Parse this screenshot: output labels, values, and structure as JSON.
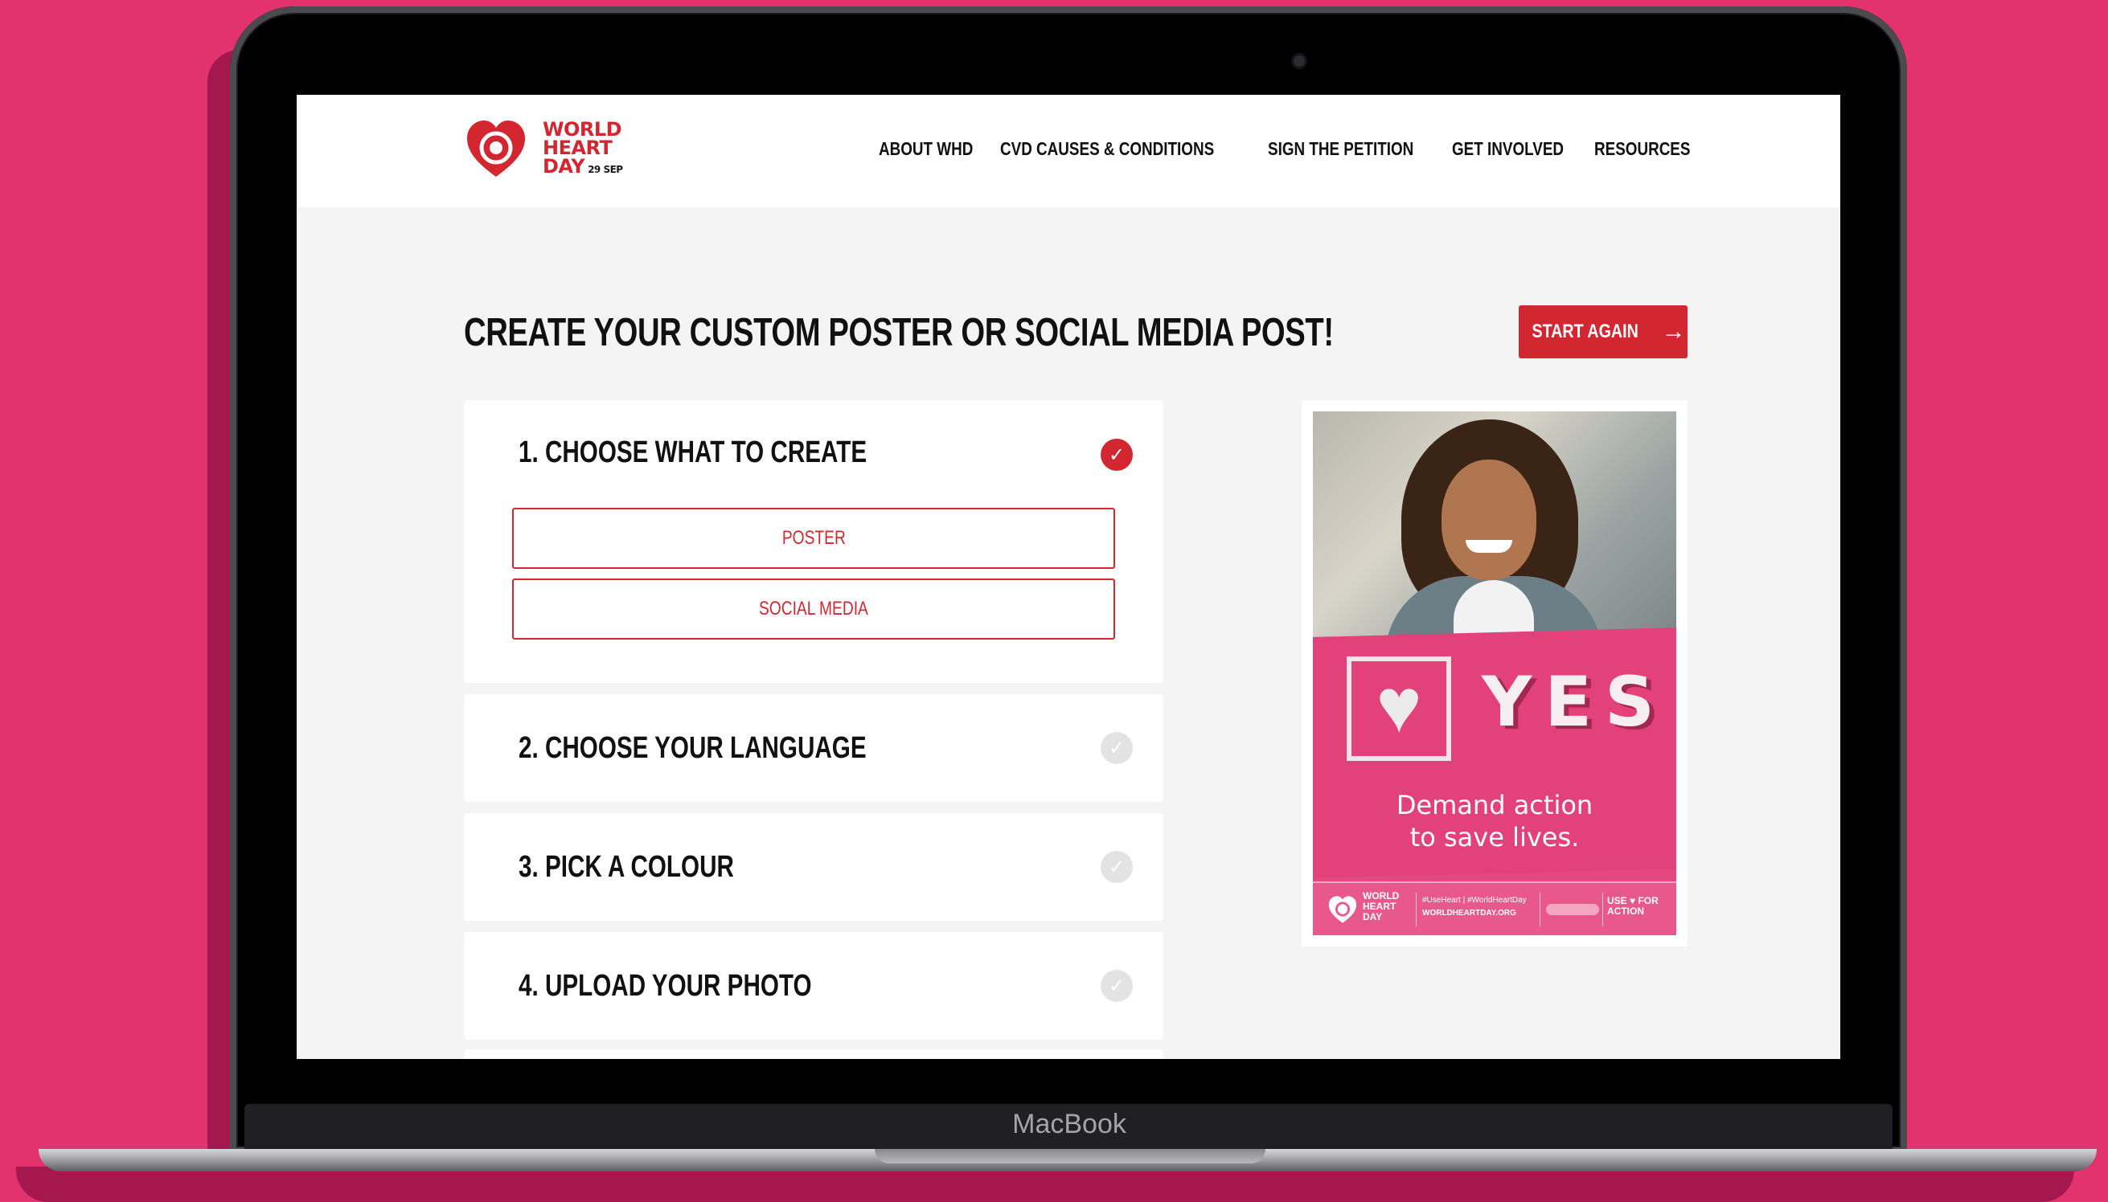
{
  "device": {
    "brand": "MacBook"
  },
  "header": {
    "logo": {
      "line1": "WORLD",
      "line2": "HEART",
      "line3": "DAY",
      "date": "29 SEP"
    },
    "nav": [
      "ABOUT WHD",
      "CVD CAUSES & CONDITIONS",
      "SIGN THE PETITION",
      "GET INVOLVED",
      "RESOURCES"
    ]
  },
  "page": {
    "title": "CREATE YOUR CUSTOM POSTER OR SOCIAL MEDIA POST!",
    "start_again": "START AGAIN",
    "start_icon": "arrow-right-icon"
  },
  "steps": [
    {
      "label": "1. CHOOSE WHAT TO CREATE",
      "status": "done",
      "options": [
        "POSTER",
        "SOCIAL MEDIA"
      ]
    },
    {
      "label": "2. CHOOSE YOUR LANGUAGE",
      "status": "pending"
    },
    {
      "label": "3. PICK A COLOUR",
      "status": "pending"
    },
    {
      "label": "4. UPLOAD YOUR PHOTO",
      "status": "pending"
    }
  ],
  "poster": {
    "headline": "YES",
    "tagline_line1": "Demand action",
    "tagline_line2": "to save lives.",
    "footer": {
      "logo_line1": "WORLD",
      "logo_line2": "HEART",
      "logo_line3": "DAY",
      "hashtags": "#UseHeart | #WorldHeartDay",
      "url": "WORLDHEARTDAY.ORG",
      "cta_line1": "USE ♥ FOR",
      "cta_line2": "ACTION"
    }
  },
  "colors": {
    "brand": "#d22630",
    "background": "#e2336f",
    "poster_pink": "#e2417a"
  }
}
